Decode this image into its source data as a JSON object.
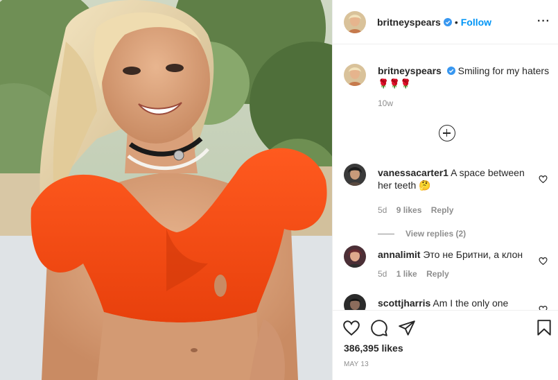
{
  "post": {
    "photo_alt": "Photo",
    "author": "britneyspears",
    "follow_label": "Follow",
    "separator": "•",
    "more_label": "···",
    "caption_text": "Smiling for my haters",
    "caption_emoji": "🌹🌹🌹",
    "caption_time": "10w",
    "likes": "386,395 likes",
    "date": "MAY 13"
  },
  "comments": [
    {
      "user": "vanessacarter1",
      "text": "A space between her teeth 🤔",
      "age": "5d",
      "likes": "9 likes",
      "reply": "Reply",
      "view_replies": "View replies (2)"
    },
    {
      "user": "annalimit",
      "text": "Это не Бритни, а клон",
      "age": "5d",
      "likes": "1 like",
      "reply": "Reply"
    },
    {
      "user": "scottjharris",
      "text": "Am I the only one"
    }
  ],
  "icons": {
    "like": "heart-icon",
    "comment": "comment-icon",
    "share": "share-icon",
    "save": "bookmark-icon",
    "load_more": "plus-circle-icon",
    "verified": "verified-badge-icon"
  },
  "colors": {
    "accent": "#0095f6",
    "verified": "#3897f0",
    "muted": "#8e8e8e",
    "text": "#262626"
  }
}
